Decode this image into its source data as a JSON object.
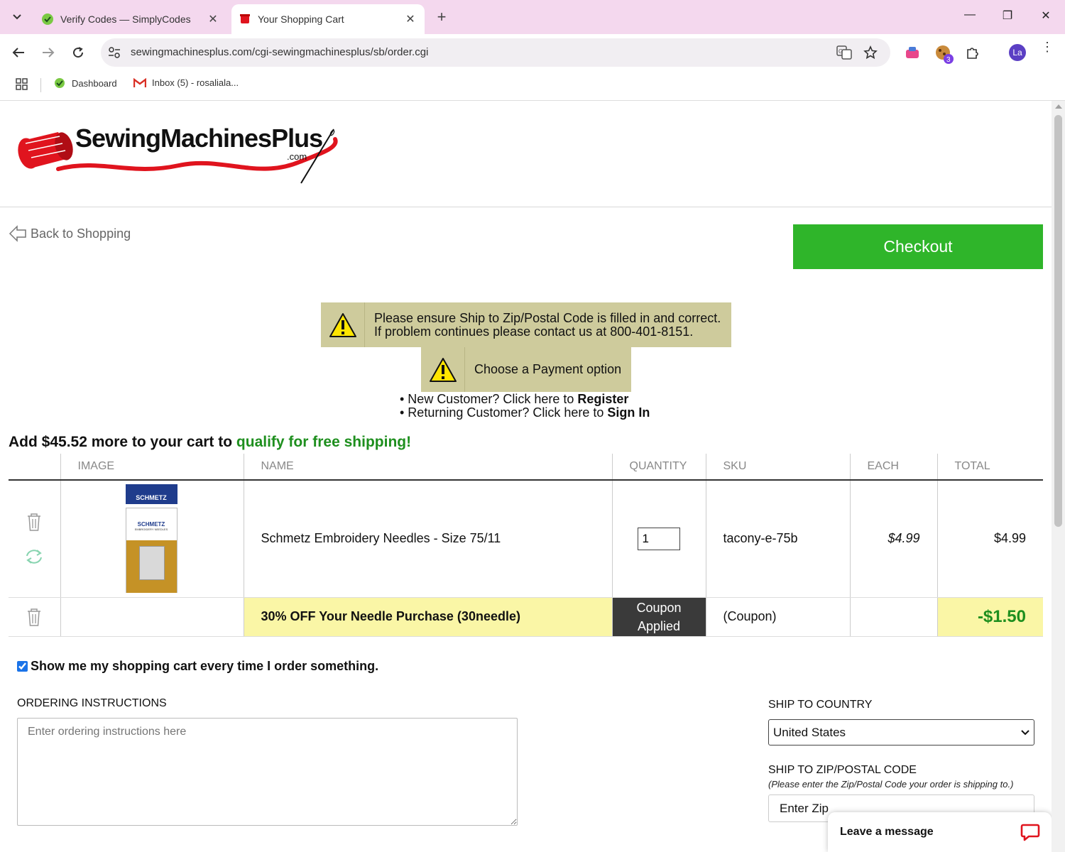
{
  "browser": {
    "tabs": [
      {
        "title": "Verify Codes — SimplyCodes",
        "active": false
      },
      {
        "title": "Your Shopping Cart",
        "active": true
      }
    ],
    "url": "sewingmachinesplus.com/cgi-sewingmachinesplus/sb/order.cgi",
    "bookmarks": [
      {
        "label": "Dashboard"
      },
      {
        "label": "Inbox (5) - rosaliala..."
      }
    ],
    "profile_initials": "La",
    "extension_badge": "3"
  },
  "site": {
    "logo_text": "SewingMachinesPlus",
    "logo_suffix": ".com",
    "brand_color": "#e0141e"
  },
  "nav": {
    "back_label": "Back to Shopping",
    "checkout_label": "Checkout"
  },
  "alerts": {
    "zip_line1": "Please ensure Ship to Zip/Postal Code is filled in and correct.",
    "zip_line2": "If problem continues please contact us at 800-401-8151.",
    "payment": "Choose a Payment option"
  },
  "account": {
    "new_prefix": "• New Customer? Click here to ",
    "new_link": "Register",
    "returning_prefix": "• Returning Customer? Click here to ",
    "returning_link": "Sign In"
  },
  "shipping_msg": {
    "prefix": "Add $45.52 more to your cart to ",
    "highlight": "qualify for free shipping!"
  },
  "cart": {
    "headers": [
      "",
      "IMAGE",
      "NAME",
      "QUANTITY",
      "SKU",
      "EACH",
      "TOTAL"
    ],
    "item": {
      "name": "Schmetz Embroidery Needles - Size 75/11",
      "quantity": "1",
      "sku": "tacony-e-75b",
      "each": "$4.99",
      "total": "$4.99",
      "package_brand": "SCHMETZ",
      "package_label": "SCHMETZ",
      "package_sublabel": "EMBROIDERY NEEDLES"
    },
    "coupon": {
      "name": "30% OFF Your Needle Purchase (30needle)",
      "status_line1": "Coupon",
      "status_line2": "Applied",
      "sku": "(Coupon)",
      "total": "-$1.50"
    }
  },
  "options": {
    "show_cart_label": "Show me my shopping cart every time I order something.",
    "show_cart_checked": true
  },
  "instructions": {
    "label": "ORDERING INSTRUCTIONS",
    "placeholder": "Enter ordering instructions here"
  },
  "ship": {
    "country_label": "SHIP TO COUNTRY",
    "country_value": "United States",
    "zip_label": "SHIP TO ZIP/POSTAL CODE",
    "zip_hint": "(Please enter the Zip/Postal Code your order is shipping to.)",
    "zip_placeholder": "Enter Zip"
  },
  "chat": {
    "label": "Leave a message"
  }
}
